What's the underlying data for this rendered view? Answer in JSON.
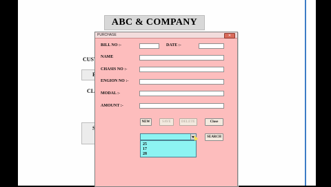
{
  "header": {
    "company": "ABC & COMPANY"
  },
  "background": {
    "label_cust": "CUST",
    "label_p": "P",
    "label_cloc": "CLO",
    "label_s": "S"
  },
  "dialog": {
    "title": "PURCHASE",
    "close_symbol": "✕",
    "fields": {
      "bill_no": {
        "label": "BILL NO :-",
        "value": ""
      },
      "date": {
        "label": "DATE :-",
        "value": ""
      },
      "name": {
        "label": "NAME",
        "value": ""
      },
      "chasis_no": {
        "label": "CHASIS NO :-",
        "value": ""
      },
      "engion_no": {
        "label": "ENGION NO :-",
        "value": ""
      },
      "modal": {
        "label": "MODAL :-",
        "value": ""
      },
      "amount": {
        "label": "AMOUNT :-",
        "value": ""
      }
    },
    "buttons": {
      "new": "NEW",
      "save": "SAVE",
      "delete": "DELETE",
      "close": "Close",
      "search": "SEARCH"
    },
    "search_combo": {
      "value": "",
      "options": [
        "25",
        "17",
        "28"
      ]
    }
  }
}
